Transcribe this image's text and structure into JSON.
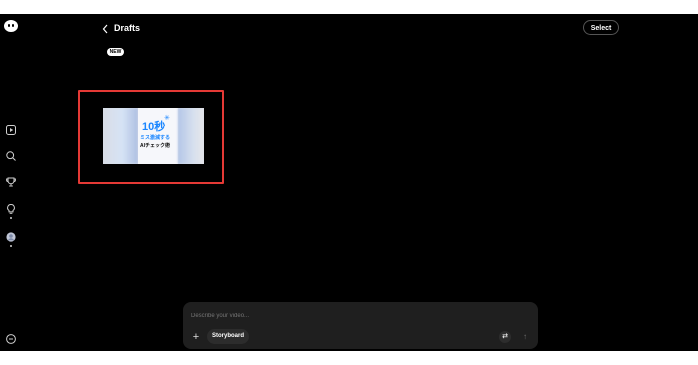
{
  "header": {
    "title": "Drafts",
    "select_label": "Select",
    "new_badge": "NEW"
  },
  "sidebar": {
    "items": [
      {
        "name": "logo-icon"
      },
      {
        "name": "play-icon"
      },
      {
        "name": "search-icon"
      },
      {
        "name": "trophy-icon"
      },
      {
        "name": "bulb-icon"
      },
      {
        "name": "profile-icon"
      },
      {
        "name": "info-icon"
      }
    ]
  },
  "draft": {
    "title_large": "10秒",
    "title_mid": "ミス激減する",
    "title_low": "AIチェック術"
  },
  "composer": {
    "placeholder": "Describe your video...",
    "storyboard_label": "Storyboard",
    "plus_icon": "+",
    "mix_icon": "⇄",
    "send_icon": "↑"
  },
  "colors": {
    "app_bg": "#000000",
    "highlight": "#e53935",
    "accent_blue": "#1a86ff"
  }
}
